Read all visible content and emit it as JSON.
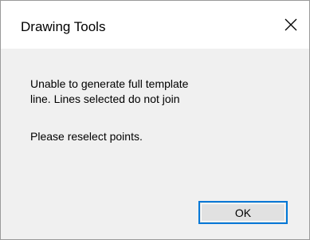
{
  "window": {
    "title": "Drawing Tools",
    "close_icon": "close-icon"
  },
  "message": {
    "line1": "Unable to generate full template",
    "line2": "line. Lines selected do not join",
    "line3": "Please reselect points."
  },
  "buttons": {
    "ok_label": "OK"
  },
  "colors": {
    "titlebar_bg": "#ffffff",
    "content_bg": "#f0f0f0",
    "button_bg": "#e1e1e1",
    "button_focus_border": "#0078d7"
  }
}
